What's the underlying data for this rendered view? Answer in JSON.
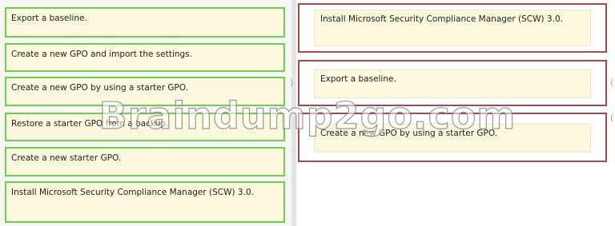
{
  "source_items": [
    {
      "label": "Export a baseline."
    },
    {
      "label": "Create a new GPO and import the settings."
    },
    {
      "label": "Create a new GPO by using a starter GPO."
    },
    {
      "label": "Restore a starter GPO from a backup."
    },
    {
      "label": "Create a new starter GPO."
    },
    {
      "label": "Install Microsoft Security Compliance Manager (SCW) 3.0."
    }
  ],
  "answer_slots": [
    {
      "label": "Install Microsoft Security Compliance Manager (SCW) 3.0."
    },
    {
      "label": "Export a baseline."
    },
    {
      "label": "Create a new GPO by using a starter GPO."
    }
  ],
  "watermark": "Braindump2go.com",
  "colors": {
    "source_border": "#6dcf52",
    "slot_border": "#a84a4a",
    "item_fill": "#fbf8de"
  }
}
